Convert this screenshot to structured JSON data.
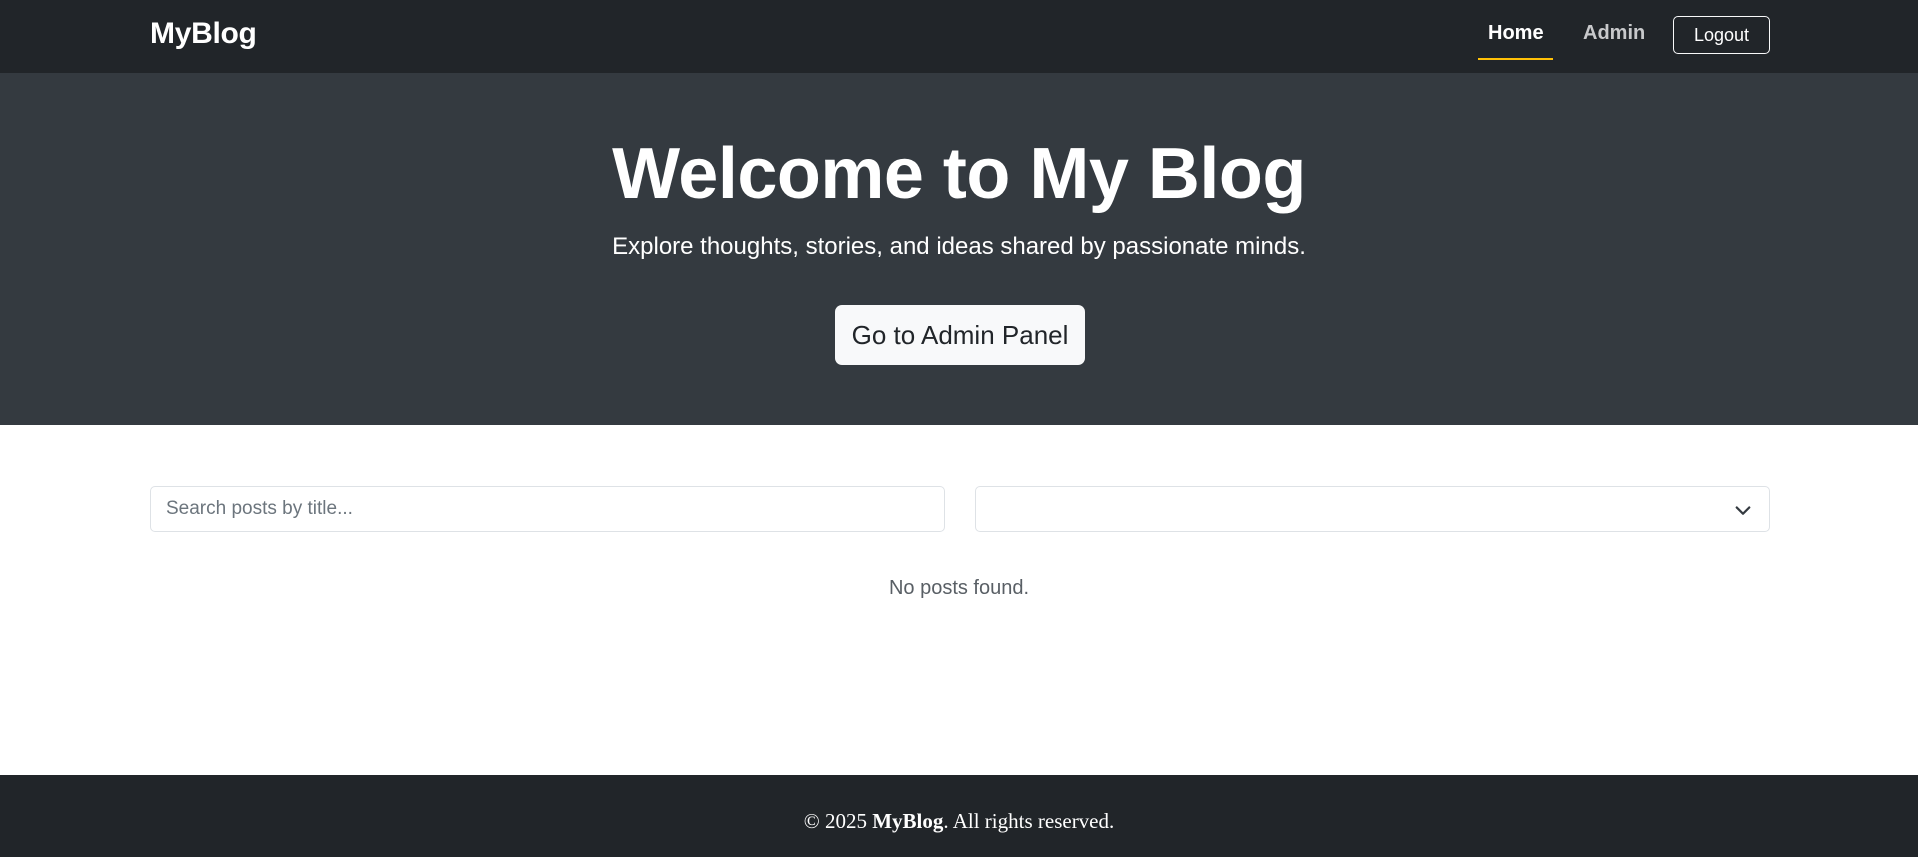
{
  "navbar": {
    "brand": "MyBlog",
    "links": [
      {
        "label": "Home",
        "active": true
      },
      {
        "label": "Admin",
        "active": false
      }
    ],
    "logout_label": "Logout"
  },
  "hero": {
    "title": "Welcome to My Blog",
    "subtitle": "Explore thoughts, stories, and ideas shared by passionate minds.",
    "button_label": "Go to Admin Panel"
  },
  "filters": {
    "search_placeholder": "Search posts by title...",
    "search_value": "",
    "category_selected": "",
    "category_icon": "chevron-down-icon"
  },
  "posts": {
    "empty_message": "No posts found."
  },
  "footer": {
    "copyright_prefix": "© 2025 ",
    "brand": "MyBlog",
    "copyright_suffix": ". All rights reserved."
  },
  "colors": {
    "navbar_bg": "#212529",
    "hero_bg": "#343a40",
    "active_underline": "#ffc107",
    "footer_bg": "#212529"
  }
}
